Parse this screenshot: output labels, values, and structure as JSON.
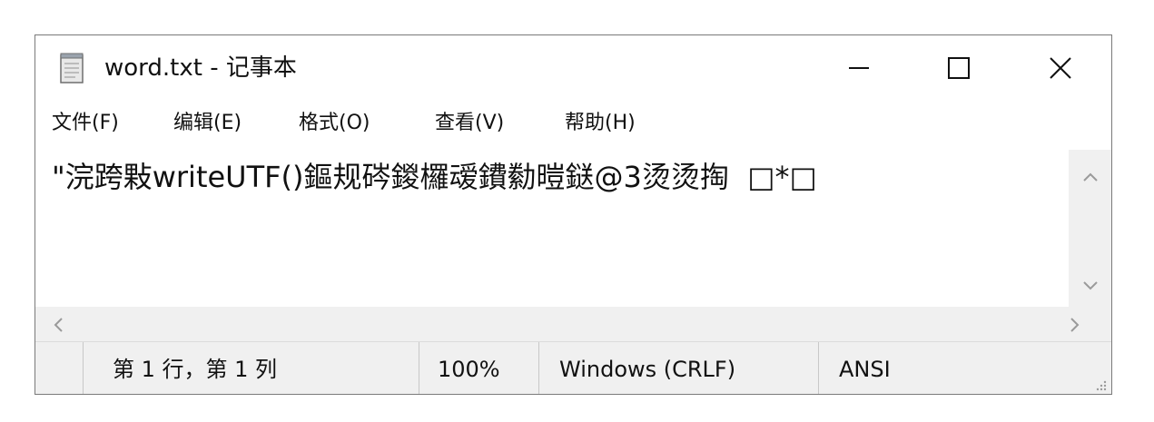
{
  "window": {
    "title": "word.txt - 记事本",
    "icon": "notepad-icon",
    "controls": {
      "minimize_icon": "minimize-icon",
      "maximize_icon": "maximize-icon",
      "close_icon": "close-icon"
    }
  },
  "menu": {
    "items": [
      {
        "label": "文件(F)"
      },
      {
        "label": "编辑(E)"
      },
      {
        "label": "格式(O)"
      },
      {
        "label": "查看(V)"
      },
      {
        "label": "帮助(H)"
      }
    ]
  },
  "editor": {
    "content": "\"浣跨敤writeUTF()鏂规硶鍐欏叆鐨勬暟鎹@3烫烫掏  □*□"
  },
  "scrollbars": {
    "up_icon": "scroll-up-icon",
    "down_icon": "scroll-down-icon",
    "left_icon": "scroll-left-icon",
    "right_icon": "scroll-right-icon"
  },
  "statusbar": {
    "position": "第 1 行，第 1 列",
    "zoom": "100%",
    "line_ending": "Windows (CRLF)",
    "encoding": "ANSI"
  },
  "colors": {
    "chrome_bg": "#f0f0f0",
    "border": "#7a7a7a",
    "text": "#111111"
  }
}
